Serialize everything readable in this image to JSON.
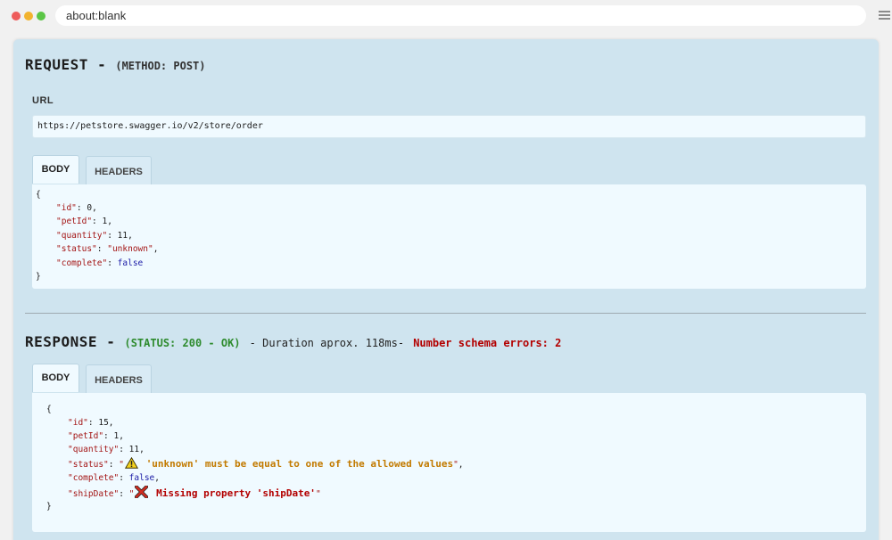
{
  "browser": {
    "address": "about:blank"
  },
  "request": {
    "title": "REQUEST -",
    "method": "(METHOD: POST)",
    "url_label": "URL",
    "url": "https://petstore.swagger.io/v2/store/order",
    "tabs": [
      "BODY",
      "HEADERS"
    ],
    "body": {
      "open": "{",
      "close": "}",
      "lines": [
        {
          "key": "\"id\"",
          "value": "0",
          "trail": ","
        },
        {
          "key": "\"petId\"",
          "value": "1",
          "trail": ","
        },
        {
          "key": "\"quantity\"",
          "value": "11",
          "trail": ","
        },
        {
          "key": "\"status\"",
          "value": "\"unknown\"",
          "trail": ","
        },
        {
          "key": "\"complete\"",
          "value": "false",
          "trail": ""
        }
      ]
    }
  },
  "response": {
    "title": "RESPONSE -",
    "status": "(STATUS: 200 - OK)",
    "duration": "- Duration aprox. 118ms-",
    "errors": "Number schema errors: 2",
    "tabs": [
      "BODY",
      "HEADERS"
    ],
    "body": {
      "open": "{",
      "close": "}",
      "lines": [
        {
          "key": "\"id\"",
          "value": "15",
          "trail": ","
        },
        {
          "key": "\"petId\"",
          "value": "1",
          "trail": ","
        },
        {
          "key": "\"quantity\"",
          "value": "11",
          "trail": ","
        },
        {
          "key": "\"status\"",
          "quote_open": "\"",
          "icon": "warning-icon",
          "message": "'unknown' must be equal to one of the allowed values",
          "quote_close": "\"",
          "trail": ","
        },
        {
          "key": "\"complete\"",
          "value": "false",
          "trail": ","
        },
        {
          "key": "\"shipDate\"",
          "quote_open": "\"",
          "icon": "error-x-icon",
          "message": "Missing property 'shipDate'",
          "quote_close": "\"",
          "trail": ""
        }
      ]
    }
  },
  "colors": {
    "panel": "#cfe4ef",
    "code_bg": "#f0faff",
    "key": "#a31515",
    "status_ok": "#2e8b2e",
    "error": "#b30000",
    "warning": "#c27a00"
  }
}
